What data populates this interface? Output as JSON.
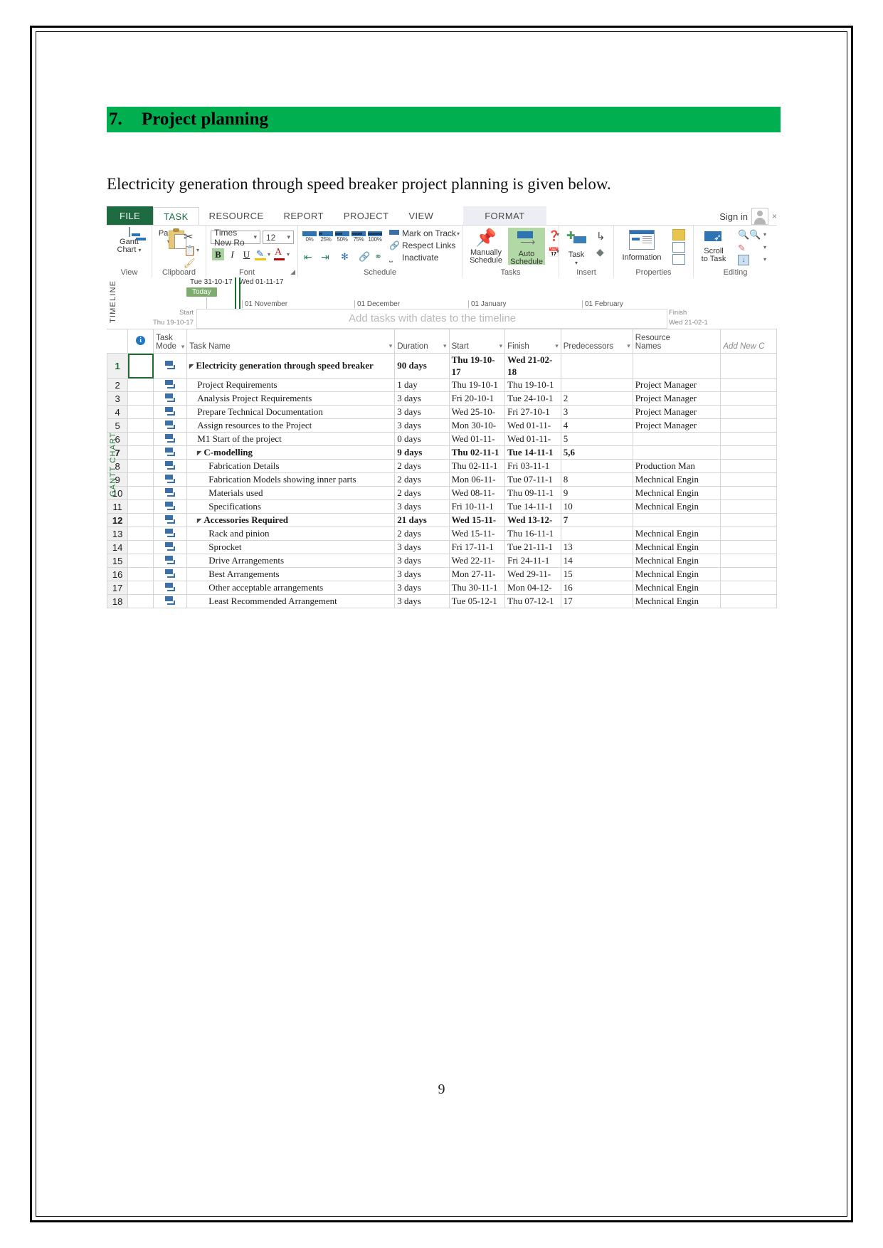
{
  "document": {
    "heading_number": "7.",
    "heading_text": "Project planning",
    "heading_bg": "#00B050",
    "intro": "Electricity generation through speed breaker project planning is given below.",
    "page_number": "9"
  },
  "app": {
    "signin": {
      "label": "Sign in",
      "avatar": "person-avatar-icon",
      "extra": "×"
    },
    "tabs": [
      {
        "label": "FILE",
        "state": "file"
      },
      {
        "label": "TASK",
        "state": "active"
      },
      {
        "label": "RESOURCE",
        "state": "normal"
      },
      {
        "label": "REPORT",
        "state": "normal"
      },
      {
        "label": "PROJECT",
        "state": "normal"
      },
      {
        "label": "VIEW",
        "state": "normal"
      },
      {
        "label": "FORMAT",
        "state": "contextual"
      }
    ],
    "ribbon": {
      "groups": [
        {
          "name": "View",
          "label": "View"
        },
        {
          "name": "Clipboard",
          "label": "Clipboard"
        },
        {
          "name": "Font",
          "label": "Font"
        },
        {
          "name": "Schedule",
          "label": "Schedule"
        },
        {
          "name": "Tasks",
          "label": "Tasks"
        },
        {
          "name": "Insert",
          "label": "Insert"
        },
        {
          "name": "Properties",
          "label": "Properties"
        },
        {
          "name": "Editing",
          "label": "Editing"
        }
      ],
      "view": {
        "button_line1": "Gantt",
        "button_line2": "Chart"
      },
      "clipboard": {
        "paste_label": "Paste"
      },
      "font": {
        "font_name": "Times New Ro",
        "font_size": "12",
        "bold": "B",
        "italic": "I",
        "underline": "U",
        "fill_color": "A",
        "font_color": "A"
      },
      "schedule": {
        "percents": [
          "0%",
          "25%",
          "50%",
          "75%",
          "100%"
        ],
        "mark_on_track": "Mark on Track",
        "respect_links": "Respect Links",
        "inactivate": "Inactivate"
      },
      "tasks": {
        "manually_line1": "Manually",
        "manually_line2": "Schedule",
        "auto_line1": "Auto",
        "auto_line2": "Schedule"
      },
      "insert": {
        "task_label": "Task"
      },
      "properties": {
        "information_label": "Information"
      },
      "editing": {
        "scroll_line1": "Scroll",
        "scroll_line2": "to Task"
      }
    },
    "timeline": {
      "side_label": "TIMELINE",
      "today_label": "Today",
      "date_left": "Tue 31-10-17",
      "date_right": "Wed 01-11-17",
      "months": [
        "01 November",
        "01 December",
        "01 January",
        "01 February"
      ],
      "start_label": "Start",
      "start_date": "Thu 19-10-17",
      "finish_label": "Finish",
      "finish_date": "Wed 21-02-1",
      "placeholder": "Add tasks with dates to the timeline"
    },
    "gantt": {
      "side_label": "GANTT CHART",
      "columns": [
        {
          "key": "rownum",
          "label": ""
        },
        {
          "key": "info",
          "label": "i"
        },
        {
          "key": "mode",
          "label": "Task Mode"
        },
        {
          "key": "name",
          "label": "Task Name"
        },
        {
          "key": "duration",
          "label": "Duration"
        },
        {
          "key": "start",
          "label": "Start"
        },
        {
          "key": "finish",
          "label": "Finish"
        },
        {
          "key": "predecessors",
          "label": "Predecessors"
        },
        {
          "key": "resources",
          "label": "Resource Names"
        },
        {
          "key": "addnew",
          "label": "Add New C"
        }
      ],
      "rows": [
        {
          "num": "1",
          "indent": 0,
          "summary": true,
          "expander": true,
          "name": "Electricity generation through speed breaker",
          "duration": "90 days",
          "start": "Thu 19-10-17",
          "finish": "Wed 21-02-18",
          "predecessors": "",
          "resources": ""
        },
        {
          "num": "2",
          "indent": 1,
          "summary": false,
          "expander": false,
          "name": "Project Requirements",
          "duration": "1 day",
          "start": "Thu 19-10-1",
          "finish": "Thu 19-10-1",
          "predecessors": "",
          "resources": "Project Manager"
        },
        {
          "num": "3",
          "indent": 1,
          "summary": false,
          "expander": false,
          "name": "Analysis Project Requirements",
          "duration": "3 days",
          "start": "Fri 20-10-1",
          "finish": "Tue 24-10-1",
          "predecessors": "2",
          "resources": "Project Manager"
        },
        {
          "num": "4",
          "indent": 1,
          "summary": false,
          "expander": false,
          "name": "Prepare Technical Documentation",
          "duration": "3 days",
          "start": "Wed 25-10-",
          "finish": "Fri 27-10-1",
          "predecessors": "3",
          "resources": "Project Manager"
        },
        {
          "num": "5",
          "indent": 1,
          "summary": false,
          "expander": false,
          "name": "Assign resources to the Project",
          "duration": "3 days",
          "start": "Mon 30-10-",
          "finish": "Wed 01-11-",
          "predecessors": "4",
          "resources": "Project Manager"
        },
        {
          "num": "6",
          "indent": 1,
          "summary": false,
          "expander": false,
          "name": "M1 Start of the project",
          "duration": "0 days",
          "start": "Wed 01-11-",
          "finish": "Wed 01-11-",
          "predecessors": "5",
          "resources": ""
        },
        {
          "num": "7",
          "indent": 1,
          "summary": true,
          "expander": true,
          "name": "C-modelling",
          "duration": "9 days",
          "start": "Thu 02-11-1",
          "finish": "Tue 14-11-1",
          "predecessors": "5,6",
          "resources": ""
        },
        {
          "num": "8",
          "indent": 2,
          "summary": false,
          "expander": false,
          "name": "Fabrication Details",
          "duration": "2 days",
          "start": "Thu 02-11-1",
          "finish": "Fri 03-11-1",
          "predecessors": "",
          "resources": "Production Man"
        },
        {
          "num": "9",
          "indent": 2,
          "summary": false,
          "expander": false,
          "name": "Fabrication Models showing inner parts",
          "duration": "2 days",
          "start": "Mon 06-11-",
          "finish": "Tue 07-11-1",
          "predecessors": "8",
          "resources": "Mechnical Engin"
        },
        {
          "num": "10",
          "indent": 2,
          "summary": false,
          "expander": false,
          "name": "Materials used",
          "duration": "2 days",
          "start": "Wed 08-11-",
          "finish": "Thu 09-11-1",
          "predecessors": "9",
          "resources": "Mechnical Engin"
        },
        {
          "num": "11",
          "indent": 2,
          "summary": false,
          "expander": false,
          "name": "Specifications",
          "duration": "3 days",
          "start": "Fri 10-11-1",
          "finish": "Tue 14-11-1",
          "predecessors": "10",
          "resources": "Mechnical Engin"
        },
        {
          "num": "12",
          "indent": 1,
          "summary": true,
          "expander": true,
          "name": "Accessories Required",
          "duration": "21 days",
          "start": "Wed 15-11-",
          "finish": "Wed 13-12-",
          "predecessors": "7",
          "resources": ""
        },
        {
          "num": "13",
          "indent": 2,
          "summary": false,
          "expander": false,
          "name": "Rack and pinion",
          "duration": "2 days",
          "start": "Wed 15-11-",
          "finish": "Thu 16-11-1",
          "predecessors": "",
          "resources": "Mechnical Engin"
        },
        {
          "num": "14",
          "indent": 2,
          "summary": false,
          "expander": false,
          "name": "Sprocket",
          "duration": "3 days",
          "start": "Fri 17-11-1",
          "finish": "Tue 21-11-1",
          "predecessors": "13",
          "resources": "Mechnical Engin"
        },
        {
          "num": "15",
          "indent": 2,
          "summary": false,
          "expander": false,
          "name": "Drive Arrangements",
          "duration": "3 days",
          "start": "Wed 22-11-",
          "finish": "Fri 24-11-1",
          "predecessors": "14",
          "resources": "Mechnical Engin"
        },
        {
          "num": "16",
          "indent": 2,
          "summary": false,
          "expander": false,
          "name": "Best Arrangements",
          "duration": "3 days",
          "start": "Mon 27-11-",
          "finish": "Wed 29-11-",
          "predecessors": "15",
          "resources": "Mechnical Engin"
        },
        {
          "num": "17",
          "indent": 2,
          "summary": false,
          "expander": false,
          "name": "Other acceptable arrangements",
          "duration": "3 days",
          "start": "Thu 30-11-1",
          "finish": "Mon 04-12-",
          "predecessors": "16",
          "resources": "Mechnical Engin"
        },
        {
          "num": "18",
          "indent": 2,
          "summary": false,
          "expander": false,
          "name": "Least Recommended Arrangement",
          "duration": "3 days",
          "start": "Tue 05-12-1",
          "finish": "Thu 07-12-1",
          "predecessors": "17",
          "resources": "Mechnical Engin"
        }
      ]
    }
  }
}
